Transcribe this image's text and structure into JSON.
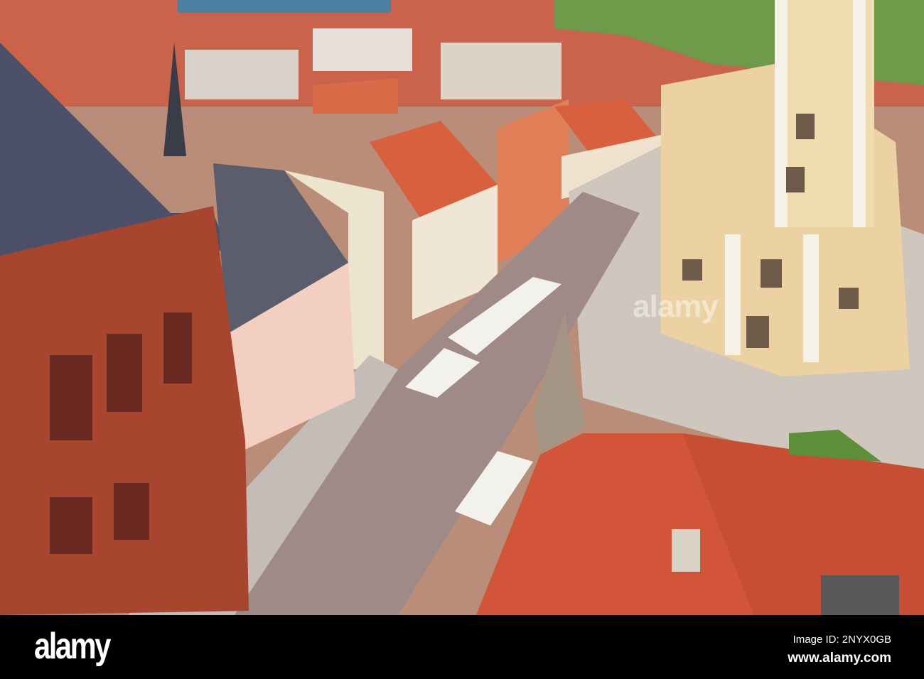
{
  "watermark": {
    "center_text": "alamy"
  },
  "footer": {
    "logo": "alamy",
    "image_id": "Image ID: 2NYX0GB",
    "url": "www.alamy.com"
  },
  "colors": {
    "roof": "#d2553a",
    "brick": "#a8452f",
    "street": "#9b8585",
    "church": "#ecd1a2",
    "slate": "#4b5068"
  }
}
